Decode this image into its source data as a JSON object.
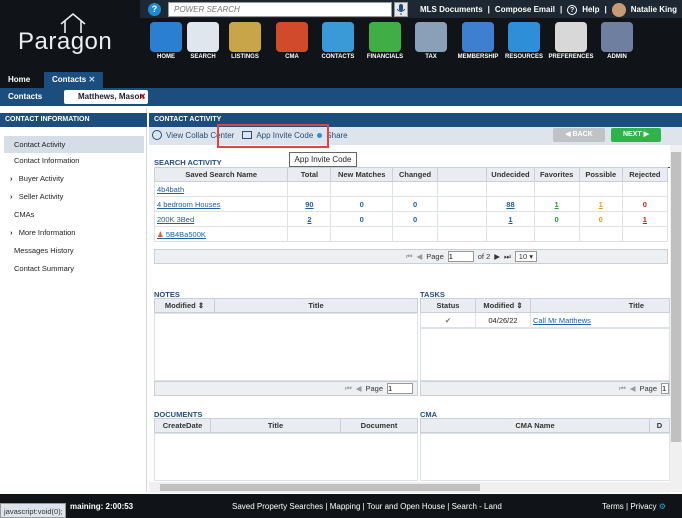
{
  "app": {
    "logo": "Paragon"
  },
  "topbar": {
    "search_placeholder": "POWER SEARCH",
    "links": [
      "MLS Documents",
      "Compose Email",
      "Help"
    ],
    "user": "Natalie King"
  },
  "nav": [
    {
      "label": "HOME",
      "icon": "home-icon",
      "color": "#2a7fd0"
    },
    {
      "label": "SEARCH",
      "icon": "search-icon",
      "color": "#dfe6ee"
    },
    {
      "label": "LISTINGS",
      "icon": "listings-icon",
      "color": "#c7a64a"
    },
    {
      "label": "CMA",
      "icon": "cma-icon",
      "color": "#d14a2a"
    },
    {
      "label": "CONTACTS",
      "icon": "contacts-icon",
      "color": "#3a9ad8"
    },
    {
      "label": "FINANCIALS",
      "icon": "financials-icon",
      "color": "#3fae45"
    },
    {
      "label": "TAX",
      "icon": "tax-icon",
      "color": "#8aa0b8"
    },
    {
      "label": "MEMBERSHIP",
      "icon": "membership-icon",
      "color": "#3f7fcf"
    },
    {
      "label": "RESOURCES",
      "icon": "resources-icon",
      "color": "#2f8ed8"
    },
    {
      "label": "PREFERENCES",
      "icon": "preferences-icon",
      "color": "#d8d8d8"
    },
    {
      "label": "ADMIN",
      "icon": "admin-icon",
      "color": "#6e7fa0"
    }
  ],
  "tabs": {
    "home": "Home",
    "contacts": "Contacts"
  },
  "subnav": {
    "section": "Contacts",
    "chip": "Matthews, Mason"
  },
  "sidebar": {
    "heading": "CONTACT INFORMATION",
    "items": [
      {
        "label": "Contact Activity",
        "active": true
      },
      {
        "label": "Contact Information"
      },
      {
        "label": "Buyer Activity",
        "expandable": true
      },
      {
        "label": "Seller Activity",
        "expandable": true
      },
      {
        "label": "CMAs"
      },
      {
        "label": "More Information",
        "expandable": true
      },
      {
        "label": "Messages History"
      },
      {
        "label": "Contact Summary"
      }
    ]
  },
  "main": {
    "heading": "CONTACT ACTIVITY",
    "toolbar": {
      "collab": "View Collab Center",
      "invite": "App Invite Code",
      "share": "Share"
    },
    "back": "BACK",
    "next": "NEXT",
    "tooltip": "App Invite Code"
  },
  "search_activity": {
    "title": "SEARCH ACTIVITY",
    "columns": [
      "Saved Search Name",
      "Total",
      "New Matches",
      "Changed",
      "",
      "Undecided",
      "Favorites",
      "Possible",
      "Rejected"
    ],
    "rows": [
      {
        "name": "4b4bath",
        "total": "",
        "new": "",
        "changed": "",
        "undecided": "",
        "favorites": "",
        "possible": "",
        "rejected": ""
      },
      {
        "name": "4 bedroom Houses",
        "total": "90",
        "new": "0",
        "changed": "0",
        "undecided": "88",
        "favorites": "1",
        "possible": "1",
        "rejected": "0"
      },
      {
        "name": "200K 3Bed",
        "total": "2",
        "new": "0",
        "changed": "0",
        "undecided": "1",
        "favorites": "0",
        "possible": "0",
        "rejected": "1"
      },
      {
        "name": "5B4Ba500K",
        "total": "",
        "new": "",
        "changed": "",
        "undecided": "",
        "favorites": "",
        "possible": "",
        "rejected": ""
      }
    ],
    "pager": {
      "page_label": "Page",
      "page": "1",
      "of": "of 2",
      "size": "10"
    }
  },
  "notes": {
    "title": "NOTES",
    "columns": [
      "Modified",
      "Title"
    ],
    "page_label": "Page",
    "page": "1"
  },
  "tasks": {
    "title": "TASKS",
    "columns": [
      "Status",
      "Modified",
      "Title"
    ],
    "rows": [
      {
        "modified": "04/26/22",
        "title": "Call Mr Matthews"
      }
    ],
    "page_label": "Page",
    "page": "1"
  },
  "documents": {
    "title": "DOCUMENTS",
    "columns": [
      "CreateDate",
      "Title",
      "Document"
    ]
  },
  "cma": {
    "title": "CMA",
    "columns": [
      "CMA Name",
      "D"
    ]
  },
  "statusbar": {
    "js": "javascript:void(0);",
    "session": "maining: 2:00:53",
    "links": [
      "Saved Property Searches",
      "Mapping",
      "Tour and Open House",
      "Search - Land"
    ],
    "right": [
      "Terms",
      "Privacy"
    ]
  }
}
